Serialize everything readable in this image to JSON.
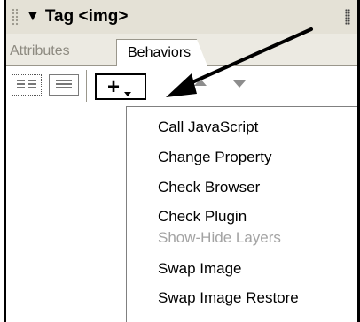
{
  "panel": {
    "title": "Tag <img>",
    "collapse_icon": "triangle-down-icon",
    "options_icon": "panel-options-grip-icon"
  },
  "tabs": [
    {
      "label": "Attributes",
      "active": false
    },
    {
      "label": "Behaviors",
      "active": true
    }
  ],
  "toolbar": {
    "show_set_events_icon": "show-set-events-icon",
    "show_all_events_icon": "show-all-events-icon",
    "add_behavior_label": "+",
    "add_behavior_icon": "dropdown-triangle-icon",
    "move_up_icon": "up-arrow-icon",
    "move_down_icon": "down-arrow-icon"
  },
  "behaviors_menu": {
    "items": [
      {
        "label": "Call JavaScript",
        "enabled": true
      },
      {
        "label": "Change Property",
        "enabled": true
      },
      {
        "label": "Check Browser",
        "enabled": true
      },
      {
        "label": "Check Plugin",
        "enabled": true
      },
      {
        "label": "Show-Hide Layers",
        "enabled": false
      },
      {
        "label": "Swap Image",
        "enabled": true
      },
      {
        "label": "Swap Image Restore",
        "enabled": true
      }
    ]
  },
  "colors": {
    "title_bg": "#e4e1d6",
    "tab_bar_bg": "#eceae2",
    "disabled_text": "#a3a3a3",
    "annotation_arrow": "#000000"
  }
}
